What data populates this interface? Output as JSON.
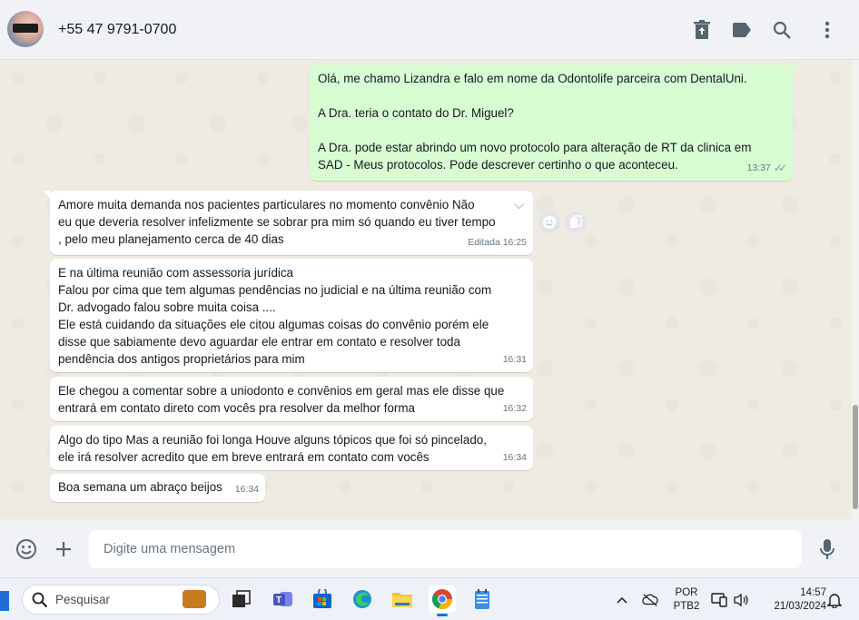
{
  "header": {
    "contact_name": "+55 47 9791-0700",
    "icons": [
      "archive-icon",
      "label-icon",
      "search-icon",
      "menu-icon"
    ]
  },
  "messages": [
    {
      "direction": "out",
      "text": "Olá, me chamo Lizandra e falo em nome da Odontolife parceira com DentalUni.\n\nA Dra. teria o contato do Dr. Miguel?\n\nA Dra. pode estar abrindo um novo protocolo para alteração de RT da clinica em\nSAD - Meus protocolos. Pode descrever certinho o que aconteceu.",
      "time": "13:37",
      "status": "read"
    },
    {
      "direction": "in",
      "text": "Amore muita demanda nos pacientes particulares no momento convênio Não\neu que deveria resolver infelizmente se sobrar pra mim só quando eu tiver tempo\n, pelo meu planejamento cerca de 40 dias",
      "time": "Editada 16:25"
    },
    {
      "direction": "in",
      "text": "E na última reunião com assessoria jurídica\nFalou por cima que tem algumas pendências no judicial e na última reunião com\nDr. advogado falou sobre muita coisa ....\nEle está cuidando da situações ele citou algumas coisas do convênio porém ele\ndisse que sabiamente devo aguardar ele entrar em contato e resolver toda\npendência dos antigos proprietários para mim",
      "time": "16:31"
    },
    {
      "direction": "in",
      "text": "Ele chegou a comentar sobre a uniodonto e convênios em geral mas ele disse que\nentrará em contato direto com vocês pra resolver da melhor forma",
      "time": "16:32"
    },
    {
      "direction": "in",
      "text": "Algo do tipo Mas a reunião foi longa Houve alguns tópicos que foi só pincelado,\nele irá resolver acredito que em breve entrará em contato com vocês",
      "time": "16:34"
    },
    {
      "direction": "in",
      "text": "Boa semana um abraço beijos",
      "time": "16:34"
    }
  ],
  "composer": {
    "placeholder": "Digite uma mensagem"
  },
  "taskbar": {
    "search_label": "Pesquisar",
    "language": "POR",
    "keyboard": "PTB2",
    "time": "14:57",
    "date": "21/03/2024"
  },
  "colors": {
    "outgoing_bubble": "#d9fdd3",
    "incoming_bubble": "#ffffff",
    "chat_background": "#efeae2",
    "header_background": "#f0f2f5"
  }
}
